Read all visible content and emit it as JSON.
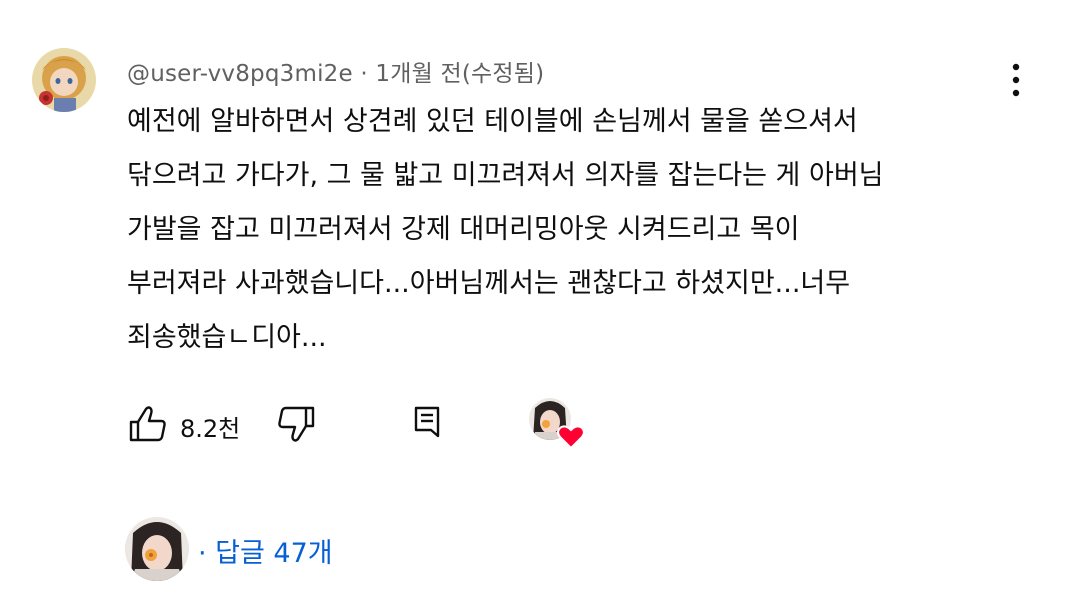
{
  "comment": {
    "author": "@user-vv8pq3mi2e",
    "separator": "·",
    "time": "1개월 전(수정됨)",
    "text_lines": [
      "예전에 알바하면서 상견례 있던 테이블에 손님께서 물을 쏟으셔서",
      "닦으려고 가다가, 그 물 밟고 미끄려져서 의자를 잡는다는 게 아버님",
      "가발을 잡고 미끄러져서 강제 대머리밍아웃 시켜드리고 목이",
      "부러져라 사과했습니다...아버님께서는 괜찮다고 하셨지만...너무",
      "죄송했습ㄴ디아..."
    ]
  },
  "actions": {
    "like_count": "8.2천",
    "like_icon": "thumb-up-icon",
    "dislike_icon": "thumb-down-icon",
    "reply_icon": "comment-reply-icon",
    "heart_icon": "creator-heart-icon"
  },
  "replies": {
    "prefix": "· ",
    "label": "답글 47개",
    "color": "#065fd4"
  }
}
